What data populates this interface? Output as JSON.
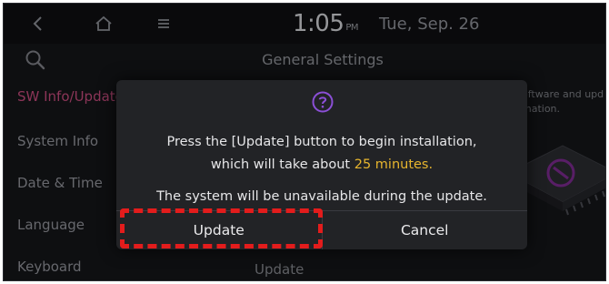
{
  "status_bar": {
    "time": "1:05",
    "ampm": "PM",
    "date": "Tue, Sep. 26"
  },
  "header": {
    "title": "General Settings"
  },
  "sidebar": {
    "items": [
      {
        "label": "SW Info/Update",
        "active": true
      },
      {
        "label": "System Info"
      },
      {
        "label": "Date & Time"
      },
      {
        "label": "Language"
      },
      {
        "label": "Keyboard"
      }
    ]
  },
  "background": {
    "description_fragment": "oftware and upd\nmation.",
    "update_label": "Update"
  },
  "dialog": {
    "line1": "Press the [Update] button to begin installation,",
    "line2_prefix": "which will take about ",
    "line2_highlight": "25 minutes",
    "line2_suffix": ".",
    "line3": "The system will be unavailable during the update.",
    "update_button": "Update",
    "cancel_button": "Cancel"
  },
  "colors": {
    "accent_highlight": "#e7b52e",
    "active_menu": "#c24a7b",
    "help_icon": "#8b4fd6",
    "annotation": "#e31c1c"
  }
}
